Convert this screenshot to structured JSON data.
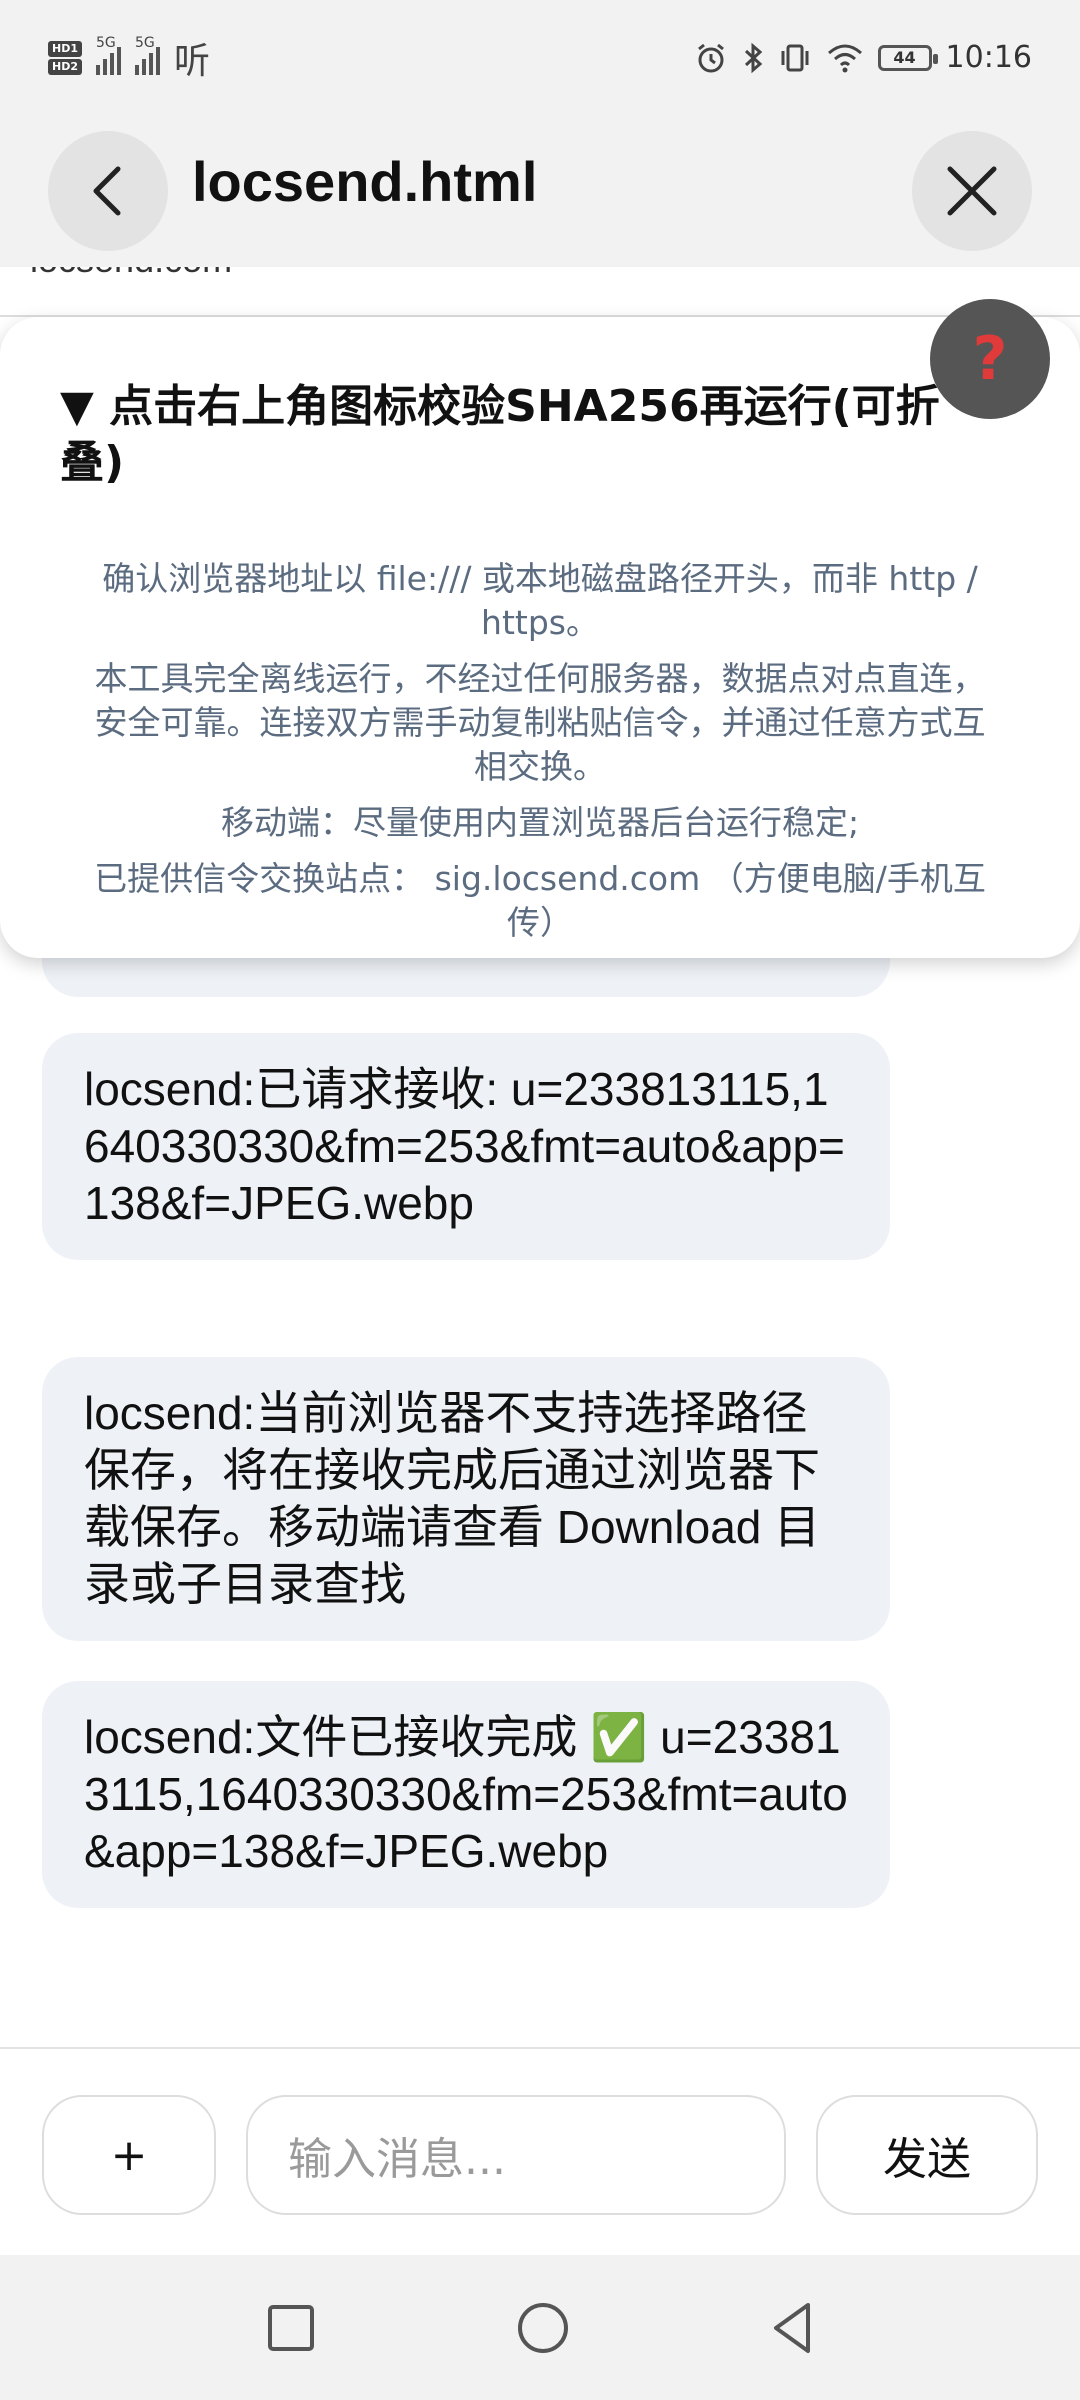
{
  "status_bar": {
    "sim1": "HD1",
    "sim2": "HD2",
    "net1": "5G",
    "net2": "5G",
    "app_icon_text": "听",
    "battery": "44",
    "time": "10:16"
  },
  "app_bar": {
    "title": "locsend.html"
  },
  "cut_text": "locsend.com",
  "notice": {
    "title": "▼ 点击右上角图标校验SHA256再运行(可折叠)",
    "lines": [
      "确认浏览器地址以 file:/// 或本地磁盘路径开头，而非 http / https。",
      "本工具完全离线运行，不经过任何服务器，数据点对点直连，安全可靠。连接双方需手动复制粘贴信令，并通过任意方式互相交换。",
      "移动端：尽量使用内置浏览器后台运行稳定;",
      "已提供信令交换站点： sig.locsend.com （方便电脑/手机互传）"
    ],
    "help_icon": "?"
  },
  "messages": [
    "locsend:已请求接收: u=233813115,1640330330&fm=253&fmt=auto&app=138&f=JPEG.webp",
    "locsend:当前浏览器不支持选择路径保存，将在接收完成后通过浏览器下载保存。移动端请查看 Download 目录或子目录查找",
    "locsend:文件已接收完成 ✅ u=233813115,1640330330&fm=253&fmt=auto&app=138&f=JPEG.webp"
  ],
  "input_bar": {
    "plus_label": "+",
    "placeholder": "输入消息...",
    "send_label": "发送"
  },
  "colors": {
    "accent": "#3a6fd8",
    "bubble": "#eef2f7",
    "notice_text": "#5b6b80"
  }
}
